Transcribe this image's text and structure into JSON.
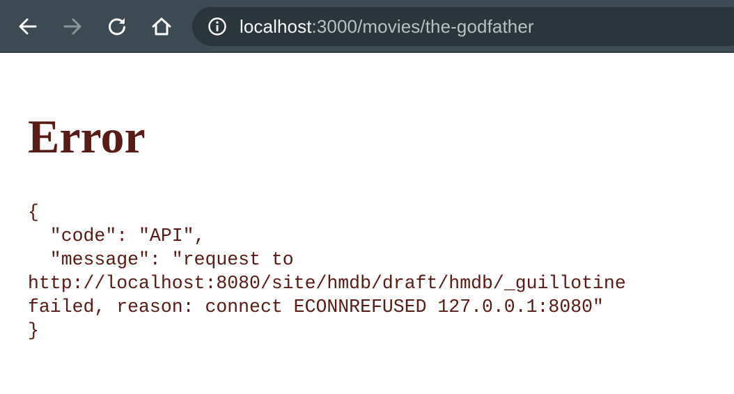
{
  "browser": {
    "url_host": "localhost",
    "url_path": ":3000/movies/the-godfather",
    "icons": {
      "back": "arrow-left-icon",
      "forward": "arrow-right-icon",
      "reload": "reload-icon",
      "home": "home-icon",
      "site_info": "info-circle-icon"
    }
  },
  "page": {
    "title": "Error",
    "body": "{\n  \"code\": \"API\",\n  \"message\": \"request to\nhttp://localhost:8080/site/hmdb/draft/hmdb/_guillotine\nfailed, reason: connect ECONNREFUSED 127.0.0.1:8080\"\n}"
  },
  "colors": {
    "toolbar_bg": "#3c4a54",
    "omnibox_bg": "#2b353c",
    "error_text": "#5a1a15"
  }
}
